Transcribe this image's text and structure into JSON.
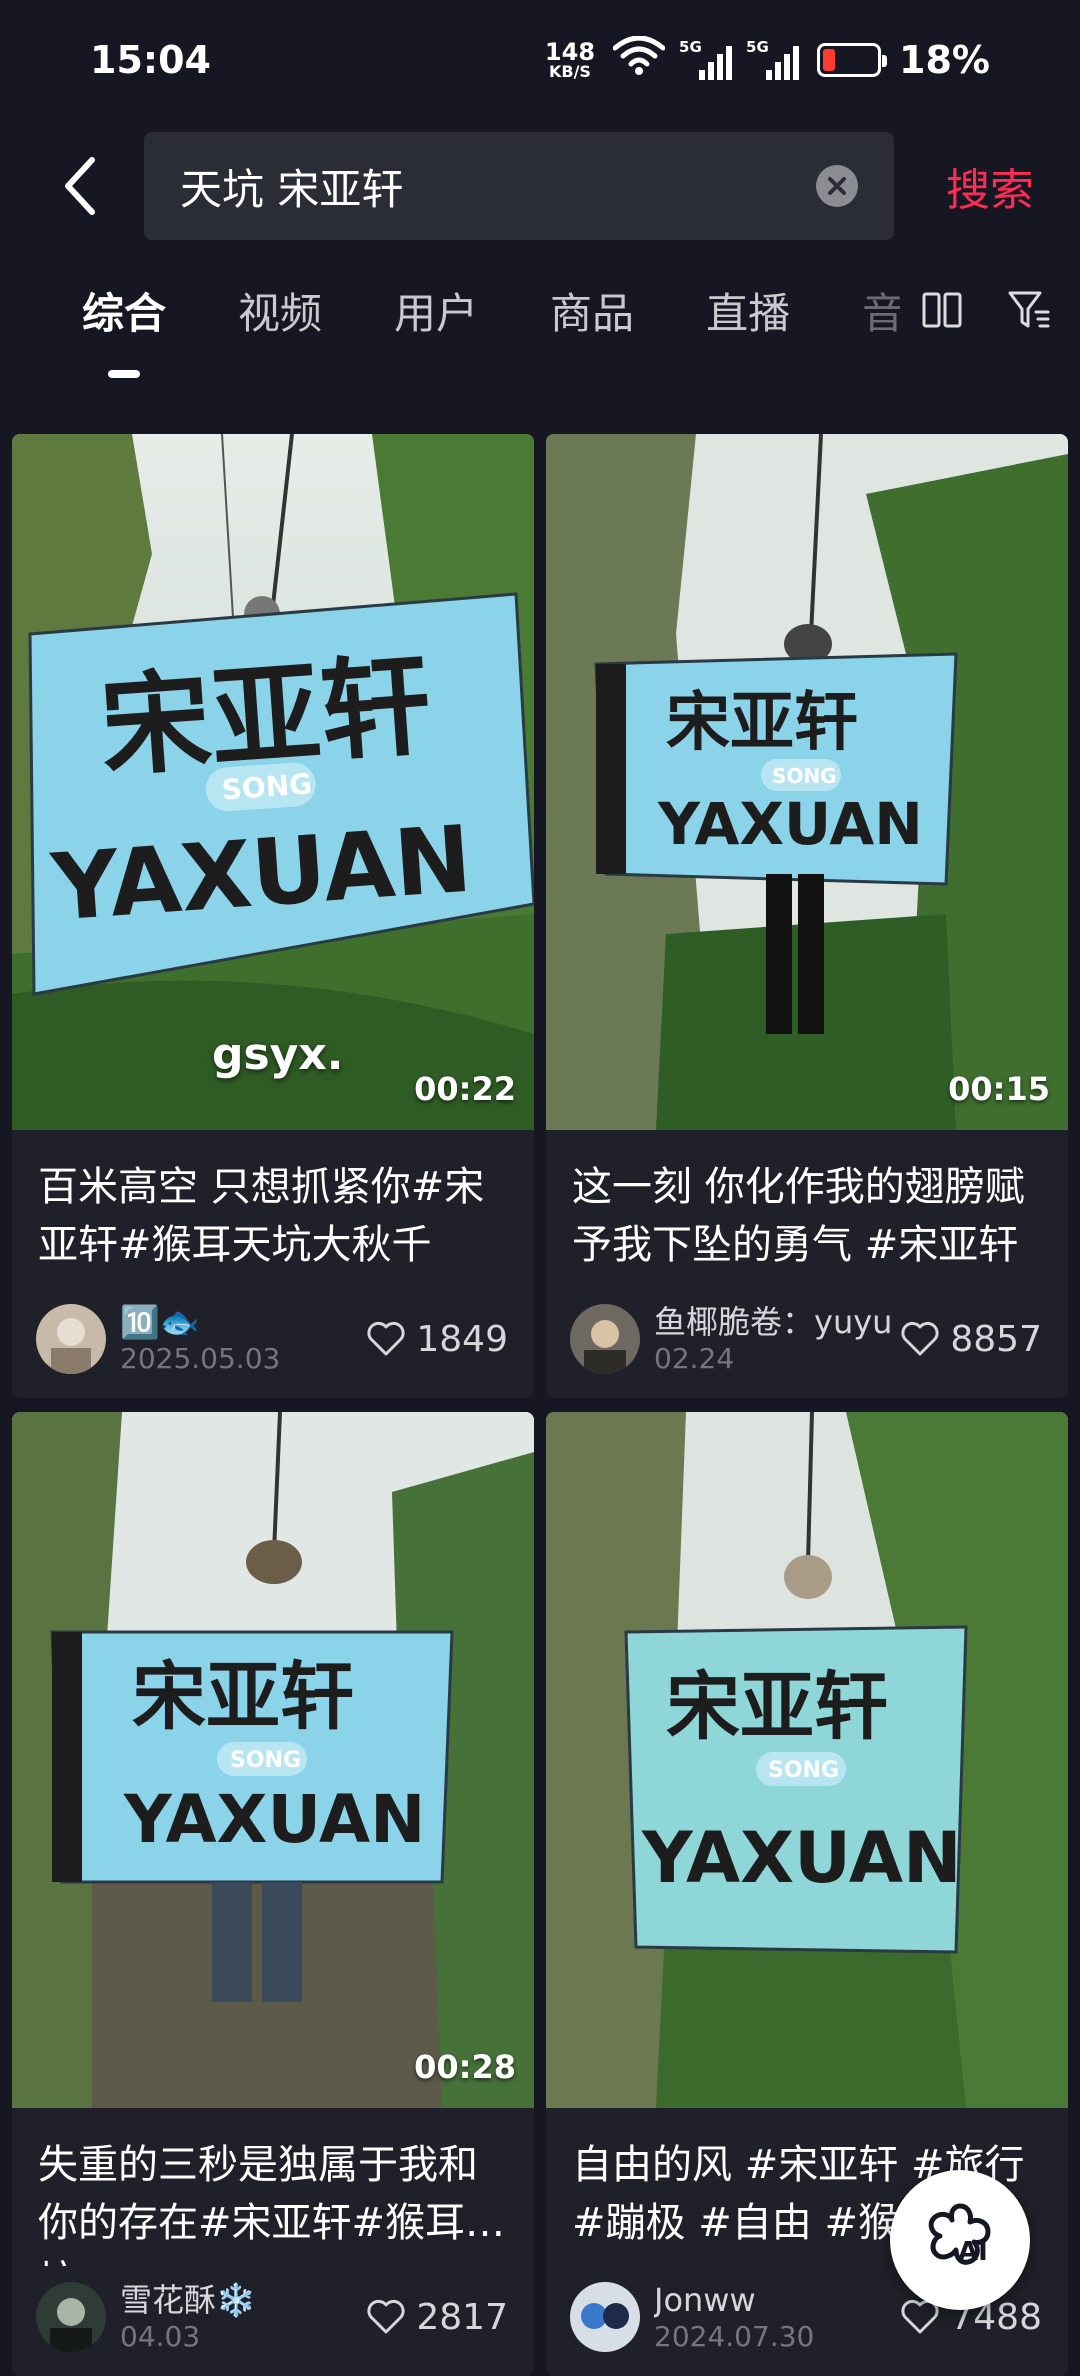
{
  "status_bar": {
    "time": "15:04",
    "net_speed": "148",
    "net_unit": "KB/S",
    "signal1": "5G",
    "signal2": "5G",
    "battery": "18%"
  },
  "search": {
    "query": "天坑 宋亚轩",
    "submit_label": "搜索"
  },
  "tabs": [
    "综合",
    "视频",
    "用户",
    "商品",
    "直播",
    "音"
  ],
  "cards": [
    {
      "duration": "00:22",
      "overlay": "gsyx.",
      "title": "百米高空 只想抓紧你#宋亚轩#猴耳天坑大秋千",
      "author": "🔟🐟",
      "date": "2025.05.03",
      "likes": "1849"
    },
    {
      "duration": "00:15",
      "title": "这一刻  你化作我的翅膀赋予我下坠的勇气 #宋亚轩",
      "author": "鱼椰脆卷：yuyu",
      "date": "02.24",
      "likes": "8857"
    },
    {
      "duration": "00:28",
      "title": "失重的三秒是独属于我和你的存在#宋亚轩#猴耳天坑",
      "author": "雪花酥❄️",
      "date": "04.03",
      "likes": "2817"
    },
    {
      "duration": "",
      "title": "自由的风 #宋亚轩 #旅行 #蹦极 #自由 #猴耳天坑",
      "author": "Jonww",
      "date": "2024.07.30",
      "likes": "7488"
    }
  ],
  "fab": {
    "label": "AI"
  },
  "banner_text": {
    "big": "宋亚轩",
    "mid": "YAXUAN",
    "pill": "SONG",
    "side": "SONGYAXUAN"
  }
}
